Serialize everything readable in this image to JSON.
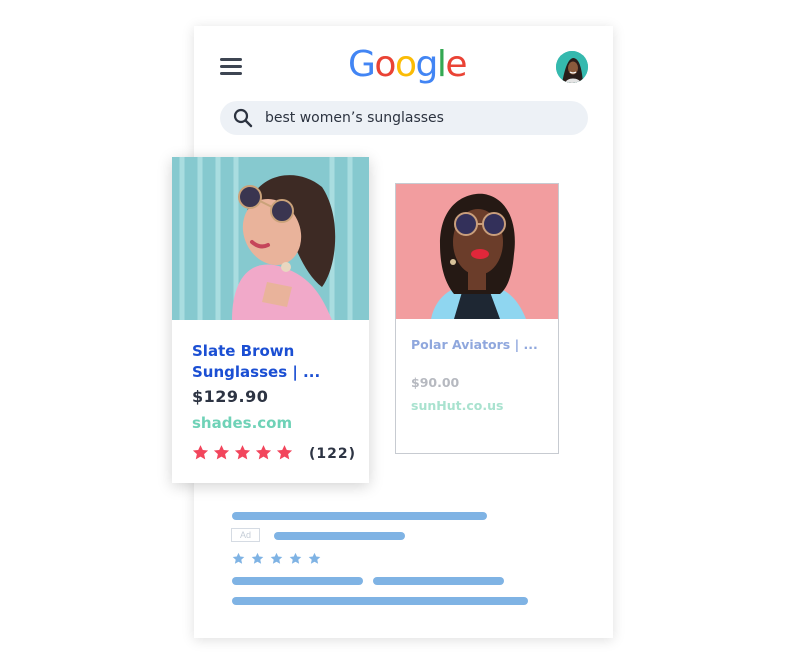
{
  "header": {
    "logo_letters": [
      {
        "char": "G",
        "color": "#4285F4"
      },
      {
        "char": "o",
        "color": "#EA4335"
      },
      {
        "char": "o",
        "color": "#FBBC05"
      },
      {
        "char": "g",
        "color": "#4285F4"
      },
      {
        "char": "l",
        "color": "#34A853"
      },
      {
        "char": "e",
        "color": "#EA4335"
      }
    ],
    "menu_icon": "hamburger-icon",
    "avatar_icon": "user-avatar"
  },
  "search": {
    "query": "best women’s sunglasses",
    "icon": "search-icon"
  },
  "results": [
    {
      "title": "Slate Brown Sunglasses | ...",
      "price": "$129.90",
      "site": "shades.com",
      "rating": 5,
      "reviews": "(122)"
    },
    {
      "title": "Polar Aviators | ...",
      "price": "$90.00",
      "site": "sunHut.co.us"
    }
  ],
  "ad_block": {
    "ad_label": "Ad",
    "rating": 5
  },
  "colors": {
    "accent_blue": "#1b4fd3",
    "site_green": "#6fd2b7",
    "star_red": "#f2455c",
    "placeholder_bar": "#7fb3e4"
  }
}
